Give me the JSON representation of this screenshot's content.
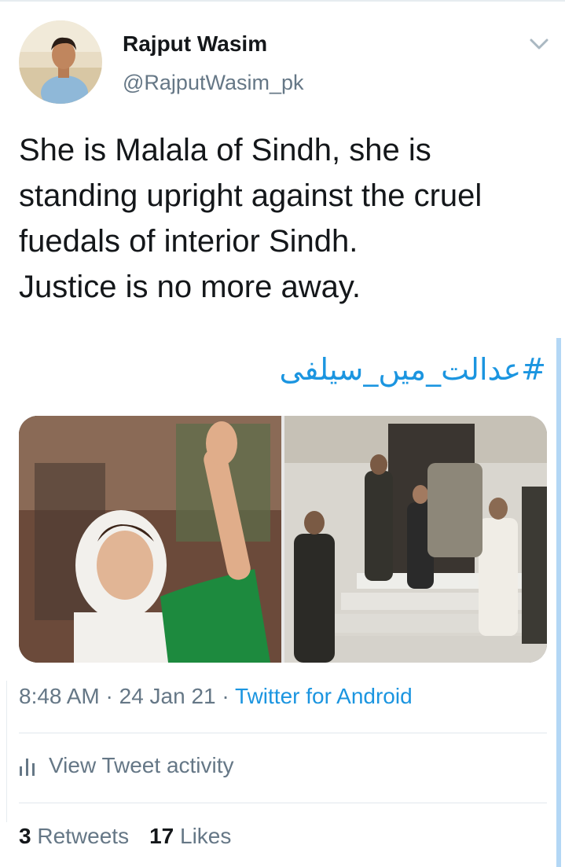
{
  "tweet": {
    "author_name": "Rajput Wasim",
    "author_handle": "@RajputWasim_pk",
    "text": "She is Malala of Sindh, she is\nstanding upright against the cruel\nfuedals of interior Sindh.\nJustice is no more away.",
    "hashtag": "#عدالت_میں_سیلفی",
    "time": "8:48 AM",
    "separator": " · ",
    "date": "24 Jan 21",
    "source": "Twitter for Android",
    "activity_label": "View Tweet activity",
    "retweets_count": "3",
    "retweets_label": "Retweets",
    "likes_count": "17",
    "likes_label": "Likes"
  },
  "icons": {
    "menu": "chevron-down-icon",
    "activity": "bar-chart-icon"
  },
  "colors": {
    "link": "#1b95e0",
    "secondary_text": "#657786",
    "primary_text": "#14171a"
  }
}
